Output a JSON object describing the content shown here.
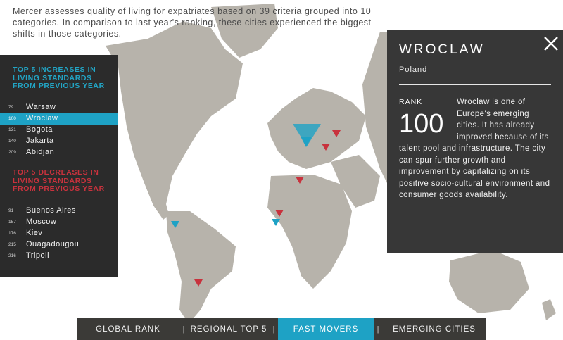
{
  "intro": "Mercer assesses quality of living for expatriates based on 39 criteria grouped into 10 categories. In comparison to last year's ranking, these cities experienced the biggest shifts in those categories.",
  "increases": {
    "title": "TOP 5 INCREASES IN LIVING STANDARDS FROM PREVIOUS YEAR",
    "items": [
      {
        "rank": "79",
        "city": "Warsaw"
      },
      {
        "rank": "100",
        "city": "Wroclaw"
      },
      {
        "rank": "131",
        "city": "Bogota"
      },
      {
        "rank": "140",
        "city": "Jakarta"
      },
      {
        "rank": "209",
        "city": "Abidjan"
      }
    ]
  },
  "decreases": {
    "title": "TOP 5 DECREASES IN LIVING STANDARDS FROM PREVIOUS YEAR",
    "items": [
      {
        "rank": "91",
        "city": "Buenos Aires"
      },
      {
        "rank": "157",
        "city": "Moscow"
      },
      {
        "rank": "176",
        "city": "Kiev"
      },
      {
        "rank": "215",
        "city": "Ouagadougou"
      },
      {
        "rank": "216",
        "city": "Tripoli"
      }
    ]
  },
  "detail": {
    "city": "WROCLAW",
    "country": "Poland",
    "rank_label": "RANK",
    "rank": "100",
    "description": "Wroclaw is one of Europe's emerging cities. It has already improved because of its talent pool and infrastructure. The city can spur further growth and improvement by capitalizing on its positive socio-cultural environment and consumer goods availability."
  },
  "tabs": [
    {
      "label": "GLOBAL RANK"
    },
    {
      "label": "REGIONAL TOP 5"
    },
    {
      "label": "FAST MOVERS"
    },
    {
      "label": "EMERGING CITIES"
    }
  ],
  "colors": {
    "land": "#b7b3ab",
    "panel": "#2b2b2b",
    "increase": "#1ea2c5",
    "decrease": "#c8323d"
  },
  "icons": [
    "close-icon",
    "increase-marker-icon",
    "decrease-marker-icon"
  ]
}
